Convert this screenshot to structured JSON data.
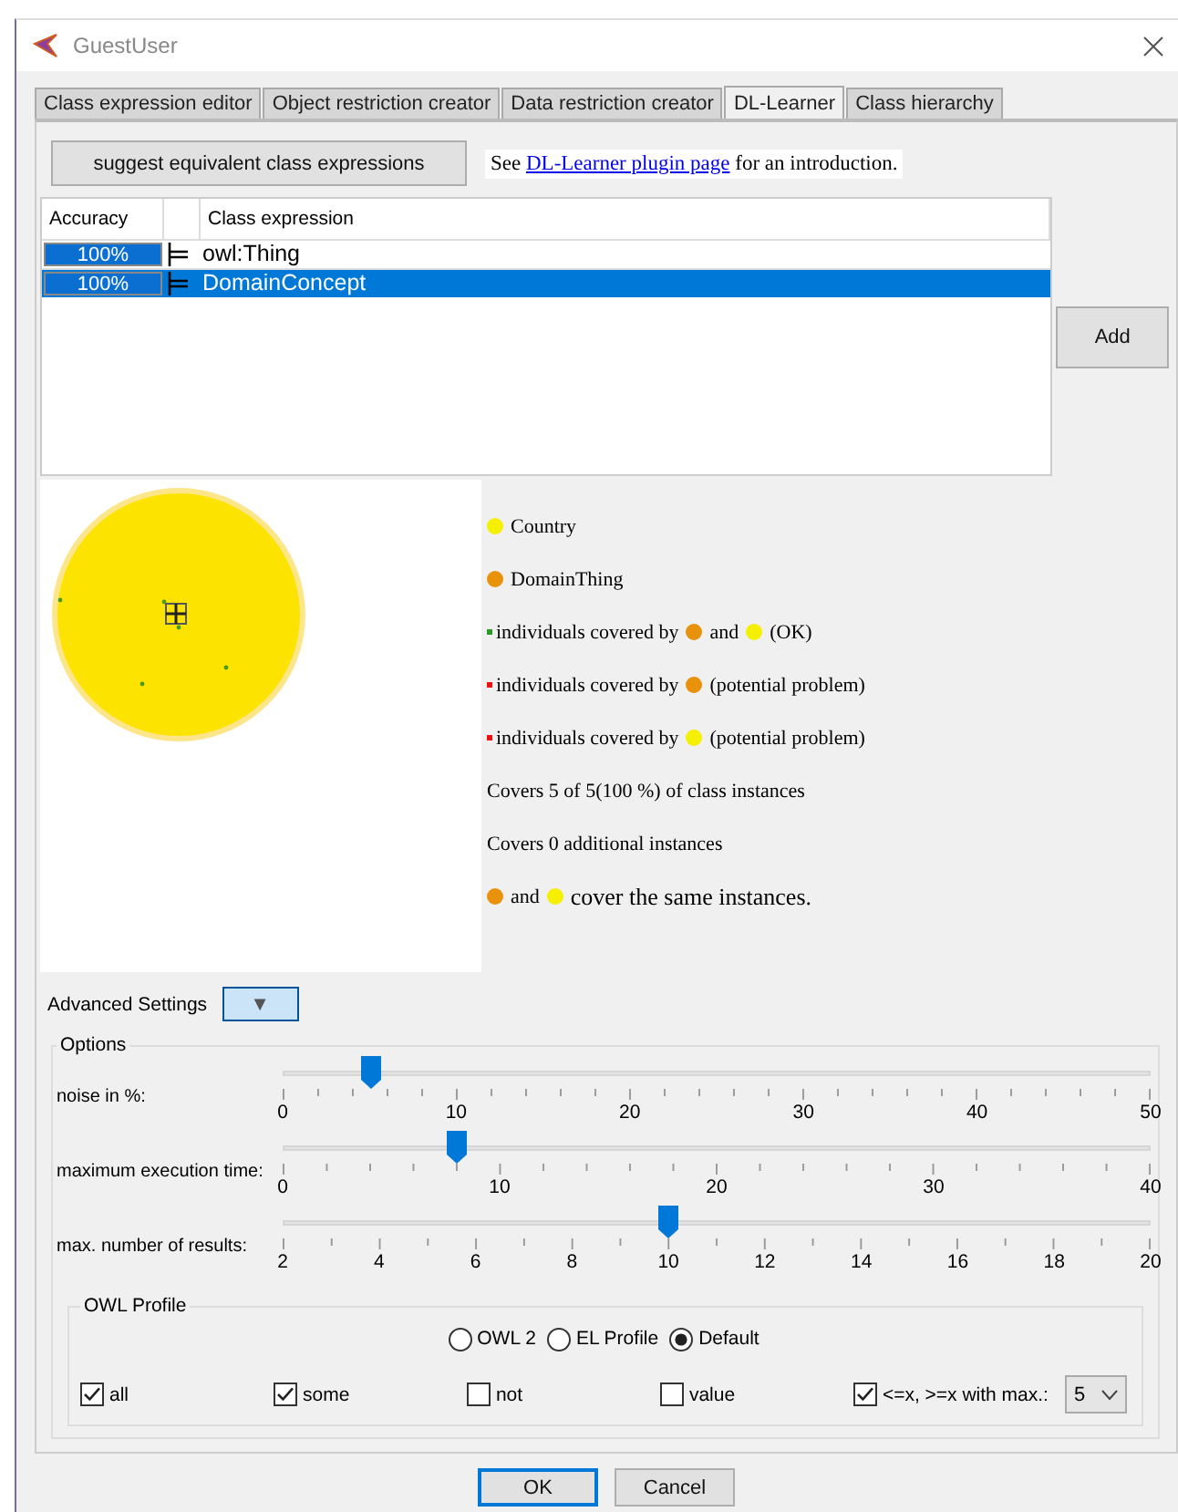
{
  "window": {
    "title": "GuestUser"
  },
  "tabs": [
    {
      "label": "Class expression editor",
      "selected": false
    },
    {
      "label": "Object restriction creator",
      "selected": false
    },
    {
      "label": "Data restriction creator",
      "selected": false
    },
    {
      "label": "DL-Learner",
      "selected": true
    },
    {
      "label": "Class hierarchy",
      "selected": false
    }
  ],
  "suggest_button": "suggest equivalent class expressions",
  "intro": {
    "before": "See",
    "link": "DL-Learner plugin page",
    "after": "for an introduction."
  },
  "table": {
    "columns": [
      "Accuracy",
      "Class expression"
    ],
    "rows": [
      {
        "accuracy": "100%",
        "level": 1,
        "expression": "owl:Thing",
        "selected": false
      },
      {
        "accuracy": "100%",
        "level": 1,
        "expression": "DomainConcept",
        "selected": true
      }
    ]
  },
  "add_button": "Add",
  "legend": [
    [
      {
        "kind": "dot",
        "color": "#f5ef00"
      },
      {
        "kind": "text",
        "text": "Country"
      }
    ],
    [
      {
        "kind": "dot",
        "color": "#e8920c"
      },
      {
        "kind": "text",
        "text": "DomainThing"
      }
    ],
    [
      {
        "kind": "marker",
        "color": "#2a9a2a"
      },
      {
        "kind": "text",
        "text": "individuals covered by"
      },
      {
        "kind": "dot",
        "color": "#e8920c"
      },
      {
        "kind": "text",
        "text": "and"
      },
      {
        "kind": "dot",
        "color": "#f5ef00"
      },
      {
        "kind": "text",
        "text": "(OK)"
      }
    ],
    [
      {
        "kind": "marker",
        "color": "#ee1111"
      },
      {
        "kind": "text",
        "text": "individuals covered by"
      },
      {
        "kind": "dot",
        "color": "#e8920c"
      },
      {
        "kind": "text",
        "text": "(potential problem)"
      }
    ],
    [
      {
        "kind": "marker",
        "color": "#ee1111"
      },
      {
        "kind": "text",
        "text": "individuals covered by"
      },
      {
        "kind": "dot",
        "color": "#f5ef00"
      },
      {
        "kind": "text",
        "text": "(potential problem)"
      }
    ],
    [
      {
        "kind": "text",
        "text": "Covers 5 of 5(100 %) of class instances"
      }
    ],
    [
      {
        "kind": "text",
        "text": "Covers 0 additional instances"
      }
    ],
    [
      {
        "kind": "dot",
        "color": "#e8920c"
      },
      {
        "kind": "text",
        "text": "and"
      },
      {
        "kind": "dot",
        "color": "#f5ef00"
      },
      {
        "kind": "big",
        "text": "cover the same instances."
      }
    ]
  ],
  "advanced": {
    "label": "Advanced Settings",
    "expanded": true,
    "toggle": "▼"
  },
  "options": {
    "title": "Options",
    "sliders": [
      {
        "label": "noise in %:",
        "level": 0.1,
        "ticks": [
          "0",
          "10",
          "20",
          "30",
          "40",
          "50"
        ]
      },
      {
        "label": "maximum execution time:",
        "level": 0.2,
        "ticks": [
          "0",
          "10",
          "20",
          "30",
          "40"
        ]
      },
      {
        "label": "max. number of results:",
        "level": 0.444,
        "ticks": [
          "2",
          "4",
          "6",
          "8",
          "10",
          "12",
          "14",
          "16",
          "18",
          "20"
        ]
      }
    ],
    "owl_profile": {
      "title": "OWL Profile",
      "radios": [
        {
          "label": "OWL 2",
          "selected": false
        },
        {
          "label": "EL Profile",
          "selected": false
        },
        {
          "label": "Default",
          "selected": true
        }
      ],
      "checks": [
        {
          "kind": "plain",
          "label": "all",
          "checked": true
        },
        {
          "kind": "plain",
          "label": "some",
          "checked": true
        },
        {
          "kind": "plain",
          "label": "not",
          "checked": false
        },
        {
          "kind": "plain",
          "label": "value",
          "checked": false
        },
        {
          "kind": "with_select",
          "label": "<=x, >=x with max.:",
          "checked": true,
          "value": "5"
        }
      ]
    }
  },
  "buttons": [
    "OK",
    "Cancel"
  ]
}
